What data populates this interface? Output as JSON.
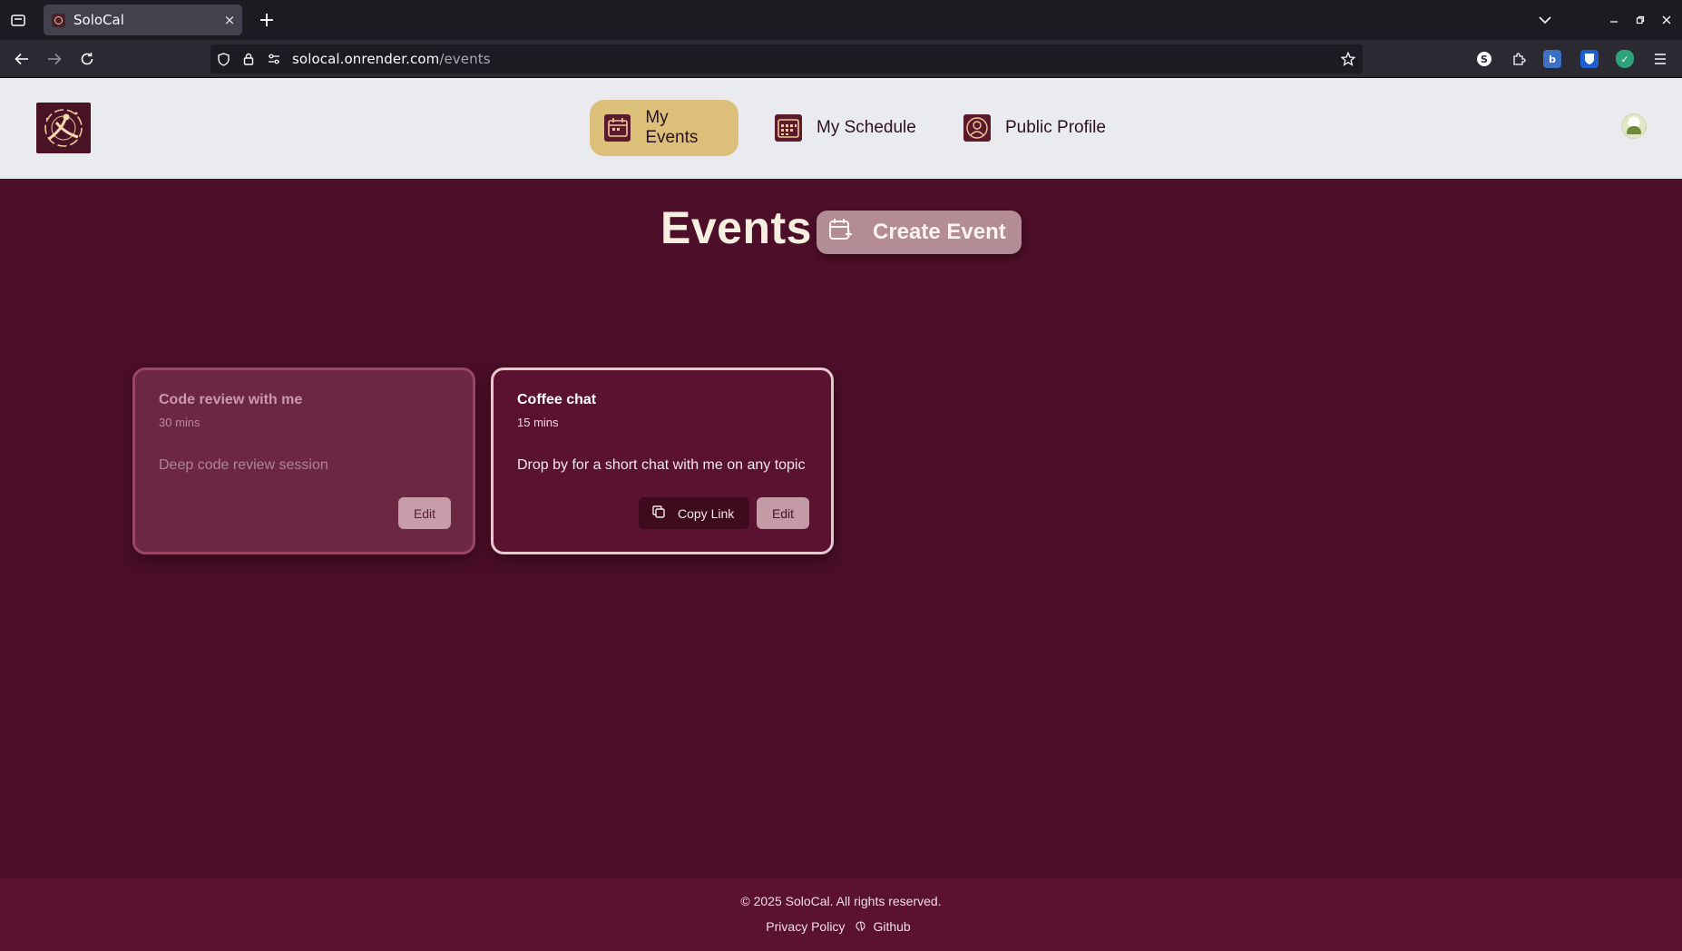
{
  "browser": {
    "tab_title": "SoloCal",
    "tab_close": "×",
    "new_tab": "+",
    "url_domain": "solocal.onrender.com",
    "url_path": "/events",
    "ext_s": "S",
    "ext_b": "b",
    "ext_check": "✓",
    "icons": [
      "tabs-list-icon",
      "back-icon",
      "forward-icon",
      "reload-icon",
      "shield-icon",
      "lock-icon",
      "site-info-icon",
      "bookmark-star-icon",
      "menu-icon"
    ]
  },
  "nav": {
    "my_events": "My Events",
    "my_schedule": "My Schedule",
    "public_profile": "Public Profile"
  },
  "main": {
    "title": "Events",
    "create_label": "Create Event"
  },
  "events": [
    {
      "title": "Code review with me",
      "duration": "30 mins",
      "description": "Deep code review session",
      "edit_label": "Edit"
    },
    {
      "title": "Coffee chat",
      "duration": "15 mins",
      "description": "Drop by for a short chat with me on any topic",
      "copy_label": "Copy Link",
      "edit_label": "Edit"
    }
  ],
  "footer": {
    "copyright": "© 2025 SoloCal. All rights reserved.",
    "privacy": "Privacy Policy",
    "github": "Github"
  },
  "colors": {
    "page_bg": "#4c0e28",
    "header_bg": "#eaebee",
    "active_nav": "#dcc07a",
    "footer_bg": "#5b1230"
  }
}
